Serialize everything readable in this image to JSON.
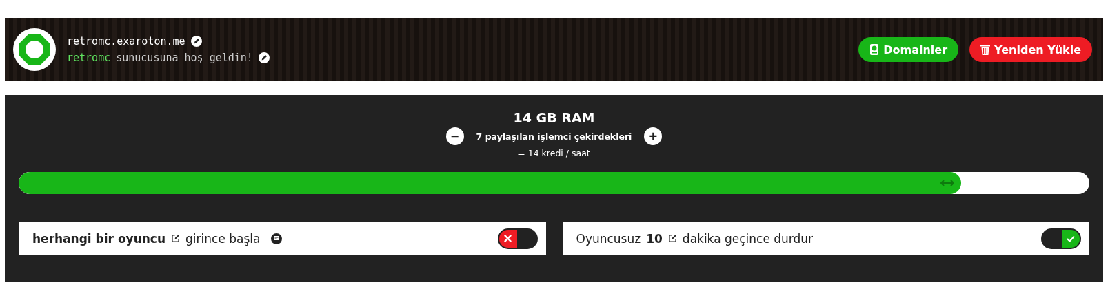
{
  "server": {
    "address": "retromc.exaroton.me",
    "motd_name": "retromc",
    "motd_text": "sunucusuna hoş geldin!"
  },
  "actions": [
    {
      "kind": "domains",
      "label": "Domainler"
    },
    {
      "kind": "reinstall",
      "label": "Yeniden Yükle"
    }
  ],
  "ram": {
    "title": "14 GB RAM",
    "cores": "7 paylaşılan işlemci çekirdekleri",
    "cost": "= 14 kredi / saat",
    "decrease": "−",
    "increase": "+",
    "level": 0.88
  },
  "settings": [
    {
      "parts": [
        {
          "kind": "value",
          "text": "herhangi bir oyuncu",
          "editable": true
        },
        {
          "kind": "text",
          "text": "girince başla"
        },
        {
          "kind": "info"
        }
      ],
      "on": false
    },
    {
      "parts": [
        {
          "kind": "text",
          "text": "Oyuncusuz"
        },
        {
          "kind": "value",
          "text": "10",
          "editable": true
        },
        {
          "kind": "text",
          "text": "dakika geçince durdur"
        }
      ],
      "on": true
    }
  ]
}
